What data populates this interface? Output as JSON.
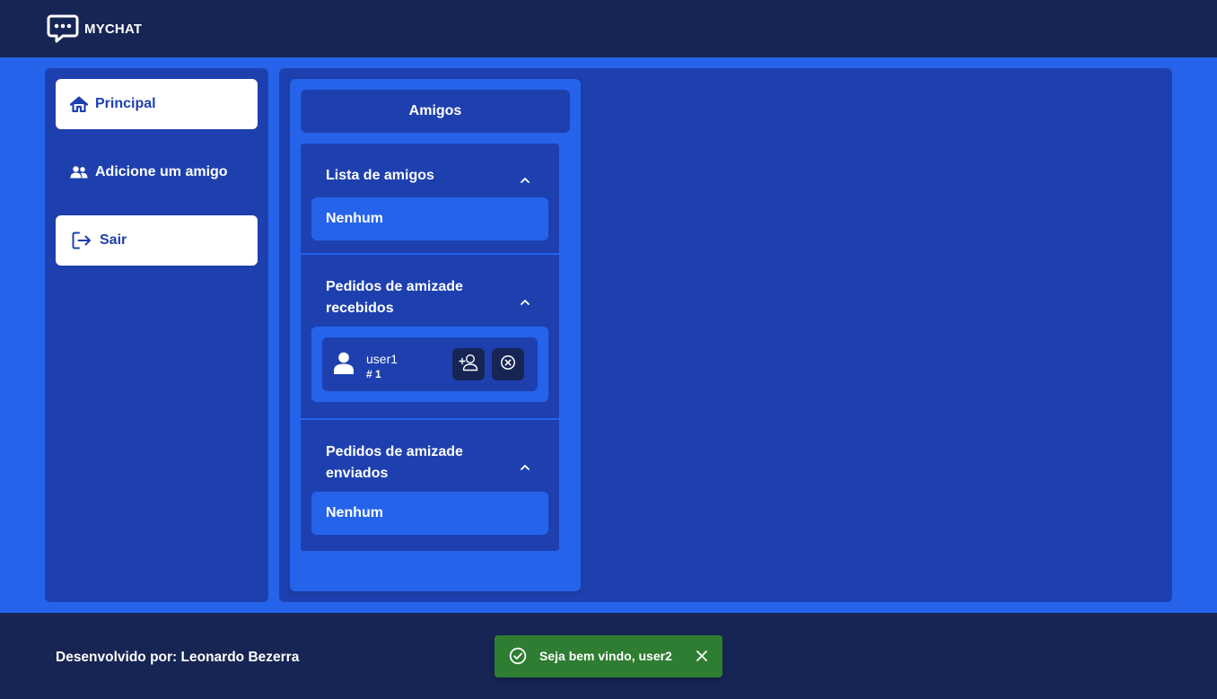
{
  "header": {
    "brand_name": "MYCHAT",
    "logo_icon": "chat-bubble-dots-icon"
  },
  "sidebar": {
    "items": [
      {
        "label": "Principal",
        "icon": "home-icon",
        "active": true
      },
      {
        "label": "Adicione um amigo",
        "icon": "users-icon",
        "active": false
      },
      {
        "label": "Sair",
        "icon": "logout-icon",
        "active": false
      }
    ]
  },
  "friends": {
    "title": "Amigos",
    "sections": [
      {
        "title": "Lista de amigos",
        "empty_label": "Nenhum"
      },
      {
        "title": "Pedidos de amizade recebidos",
        "requests": [
          {
            "username": "user1",
            "tag": "# 1"
          }
        ]
      },
      {
        "title": "Pedidos de amizade enviados",
        "empty_label": "Nenhum"
      }
    ]
  },
  "footer": {
    "credit": "Desenvolvido por: Leonardo Bezerra"
  },
  "toast": {
    "message": "Seja bem vindo, user2",
    "type": "success"
  },
  "colors": {
    "navy": "#172554",
    "panel": "#1e40af",
    "blue": "#2563eb",
    "success": "#2e7d32",
    "white": "#ffffff"
  }
}
